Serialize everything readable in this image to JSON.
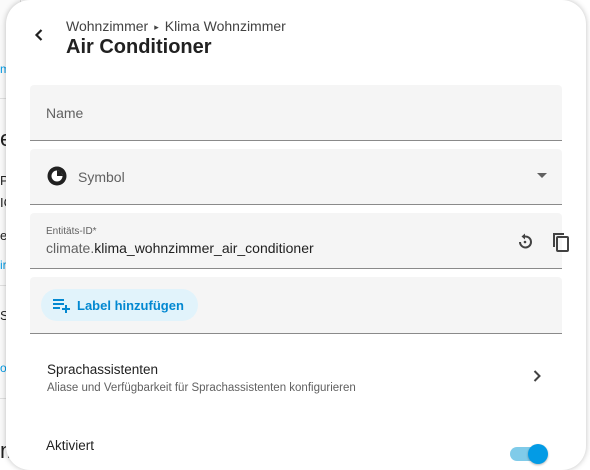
{
  "background": {
    "fragments": [
      "m",
      "e",
      "P",
      "IC",
      "e:",
      "ir",
      "S",
      "o",
      "m"
    ]
  },
  "header": {
    "breadcrumb": [
      "Wohnzimmer",
      "Klima Wohnzimmer"
    ],
    "title": "Air Conditioner"
  },
  "form": {
    "name_placeholder": "Name",
    "symbol_placeholder": "Symbol",
    "entity_label": "Entitäts-ID*",
    "entity_prefix": "climate.",
    "entity_value": "klima_wohnzimmer_air_conditioner",
    "add_label_button": "Label hinzufügen"
  },
  "voice_assistants": {
    "title": "Sprachassistenten",
    "subtitle": "Aliase und Verfügbarkeit für Sprachassistenten konfigurieren"
  },
  "enabled": {
    "title": "Aktiviert",
    "on": true
  },
  "colors": {
    "accent": "#039be5",
    "chip_bg": "#e1f3fb",
    "field_bg": "#f5f5f5"
  },
  "icons": [
    "chevron-left-icon",
    "palette-icon",
    "menu-down-icon",
    "restore-icon",
    "content-copy-icon",
    "label-plus-icon",
    "chevron-right-icon"
  ]
}
